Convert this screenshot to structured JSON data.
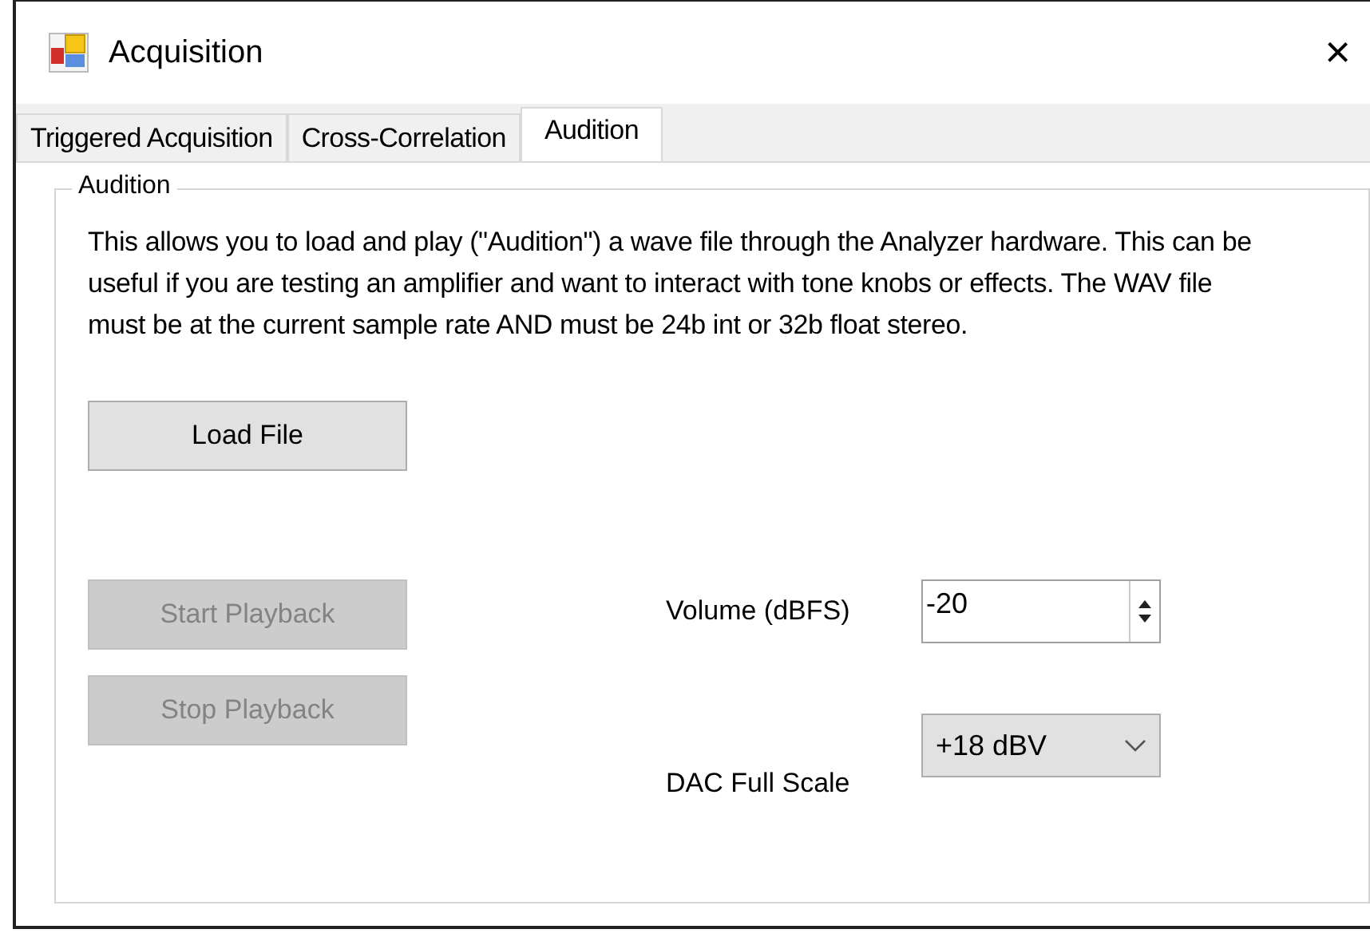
{
  "window": {
    "title": "Acquisition",
    "close": "×"
  },
  "tabs": [
    {
      "label": "Triggered Acquisition",
      "selected": false
    },
    {
      "label": "Cross-Correlation",
      "selected": false
    },
    {
      "label": "Audition",
      "selected": true
    }
  ],
  "group": {
    "title": "Audition",
    "description": "This allows you to load and play (\"Audition\") a wave file through the Analyzer hardware. This can be useful if you are testing an amplifier and want to interact with tone knobs or effects. The WAV file must be at the current sample rate AND must be 24b int or 32b float stereo."
  },
  "load_button": {
    "label": "Load File",
    "disabled": false
  },
  "playback_buttons": [
    {
      "label": "Start Playback",
      "disabled": true
    },
    {
      "label": "Stop Playback",
      "disabled": true
    }
  ],
  "volume": {
    "label": "Volume (dBFS)",
    "value": "-20"
  },
  "dac_full_scale": {
    "label": "DAC Full Scale",
    "value": "+18 dBV"
  }
}
